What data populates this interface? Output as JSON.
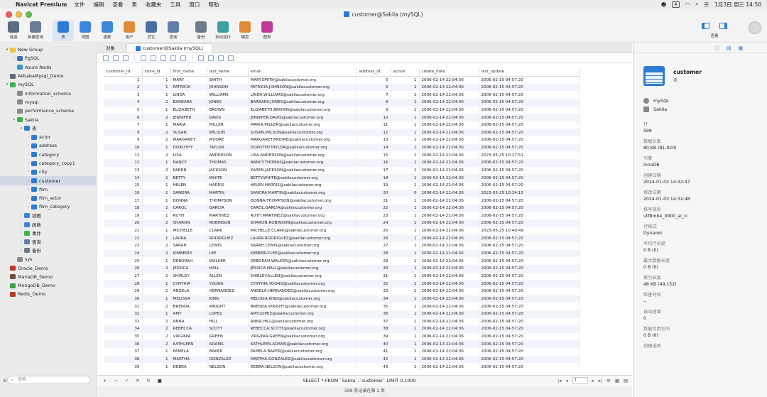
{
  "menubar": {
    "app": "Navicat Premium",
    "menus": [
      "文件",
      "编辑",
      "查看",
      "表",
      "收藏夹",
      "工具",
      "窗口",
      "帮助"
    ],
    "ime": "A",
    "datetime": "1月3日 周三 14:50"
  },
  "window": {
    "title": "customer@Sakila (mySQL)"
  },
  "toolbar": {
    "tools": [
      {
        "label": "连接",
        "icon": "connect-icon",
        "color": "#5a6b82"
      },
      {
        "label": "新建查询",
        "icon": "new-query-icon",
        "color": "#6b7c93"
      },
      {
        "label": "表",
        "icon": "table-icon",
        "color": "#2e7bd6",
        "active": true
      },
      {
        "label": "视图",
        "icon": "view-icon",
        "color": "#3b86d8"
      },
      {
        "label": "函数",
        "icon": "function-icon",
        "color": "#3b86d8"
      },
      {
        "label": "用户",
        "icon": "user-icon",
        "color": "#e08a3c"
      },
      {
        "label": "其它",
        "icon": "tools-icon",
        "color": "#4a6fa5"
      },
      {
        "label": "查询",
        "icon": "query-icon",
        "color": "#5f7fa8"
      },
      {
        "label": "备份",
        "icon": "backup-icon",
        "color": "#6c7a8a"
      },
      {
        "label": "自动运行",
        "icon": "robot-icon",
        "color": "#3aa0a0"
      },
      {
        "label": "模型",
        "icon": "model-icon",
        "color": "#e08a3c"
      },
      {
        "label": "图表",
        "icon": "chart-icon",
        "color": "#c0399a"
      }
    ],
    "view_label": "查看"
  },
  "sidebar": {
    "search_placeholder": "搜索",
    "nodes": [
      {
        "label": "New Group",
        "level": 0,
        "arrow": "▾",
        "color": "#f0c040"
      },
      {
        "label": "PgSQL",
        "level": 1,
        "arrow": "›",
        "color": "#3b6fb6"
      },
      {
        "label": "Azure Redis",
        "level": 1,
        "arrow": "",
        "color": "#2f9bd6"
      },
      {
        "label": "AlibabaMysql_Demo",
        "level": 0,
        "arrow": "",
        "color": "#5b6b7b"
      },
      {
        "label": "mySQL",
        "level": 0,
        "arrow": "▾",
        "color": "#3bb34a"
      },
      {
        "label": "information_schema",
        "level": 1,
        "arrow": "",
        "color": "#8a8a8a"
      },
      {
        "label": "mysql",
        "level": 1,
        "arrow": "",
        "color": "#8a8a8a"
      },
      {
        "label": "performance_schema",
        "level": 1,
        "arrow": "",
        "color": "#8a8a8a"
      },
      {
        "label": "Sakila",
        "level": 1,
        "arrow": "▾",
        "color": "#3bb34a"
      },
      {
        "label": "表",
        "level": 2,
        "arrow": "▾",
        "color": "#2e7bd6"
      },
      {
        "label": "actor",
        "level": 3,
        "arrow": "›",
        "color": "#2e7bd6"
      },
      {
        "label": "address",
        "level": 3,
        "arrow": "›",
        "color": "#2e7bd6"
      },
      {
        "label": "category",
        "level": 3,
        "arrow": "›",
        "color": "#2e7bd6"
      },
      {
        "label": "category_copy1",
        "level": 3,
        "arrow": "›",
        "color": "#2e7bd6"
      },
      {
        "label": "city",
        "level": 3,
        "arrow": "›",
        "color": "#2e7bd6"
      },
      {
        "label": "customer",
        "level": 3,
        "arrow": "›",
        "color": "#2e7bd6",
        "selected": true
      },
      {
        "label": "film",
        "level": 3,
        "arrow": "›",
        "color": "#2e7bd6"
      },
      {
        "label": "film_actor",
        "level": 3,
        "arrow": "›",
        "color": "#2e7bd6"
      },
      {
        "label": "film_category",
        "level": 3,
        "arrow": "›",
        "color": "#2e7bd6"
      },
      {
        "label": "视图",
        "level": 2,
        "arrow": "›",
        "color": "#3b86d8"
      },
      {
        "label": "函数",
        "level": 2,
        "arrow": "›",
        "color": "#3b86d8"
      },
      {
        "label": "事件",
        "level": 2,
        "arrow": "›",
        "color": "#3bb34a"
      },
      {
        "label": "查询",
        "level": 2,
        "arrow": "›",
        "color": "#5f7fa8"
      },
      {
        "label": "备份",
        "level": 2,
        "arrow": "›",
        "color": "#6c7a8a"
      },
      {
        "label": "sys",
        "level": 1,
        "arrow": "",
        "color": "#8a8a8a"
      },
      {
        "label": "Oracle_Demo",
        "level": 0,
        "arrow": "",
        "color": "#c0392b"
      },
      {
        "label": "MariaDB_Demo",
        "level": 0,
        "arrow": "",
        "color": "#6b4f3b"
      },
      {
        "label": "MongoDB_Demo",
        "level": 0,
        "arrow": "",
        "color": "#3aa04a"
      },
      {
        "label": "Redis_Demo",
        "level": 0,
        "arrow": "",
        "color": "#c0392b"
      }
    ]
  },
  "tabs": [
    {
      "label": "对象",
      "active": false
    },
    {
      "label": "customer@Sakila (mySQL)",
      "active": true
    }
  ],
  "grid": {
    "columns": [
      "customer_id",
      "store_id",
      "first_name",
      "last_name",
      "email",
      "address_id",
      "active",
      "create_date",
      "last_update"
    ],
    "rows": [
      [
        "1",
        "1",
        "MARY",
        "SMITH",
        "MARY.SMITH@sakilacustomer.org",
        "5",
        "1",
        "2006-02-14 22:04:36",
        "2006-02-15 04:57:20"
      ],
      [
        "2",
        "1",
        "PATRICIA",
        "JOHNSON",
        "PATRICIA.JOHNSON@sakilacustomer.org",
        "6",
        "1",
        "2006-02-14 22:04:36",
        "2006-02-15 04:57:20"
      ],
      [
        "3",
        "1",
        "LINDA",
        "WILLIAMS",
        "LINDA.WILLIAMS@sakilacustomer.org",
        "7",
        "1",
        "2006-02-14 22:04:36",
        "2006-02-15 04:57:20"
      ],
      [
        "4",
        "2",
        "BARBARA",
        "JONES",
        "BARBARA.JONES@sakilacustomer.org",
        "8",
        "1",
        "2006-02-14 22:04:36",
        "2006-02-15 04:57:20"
      ],
      [
        "5",
        "1",
        "ELIZABETH",
        "BROWN",
        "ELIZABETH.BROWN@sakilacustomer.org",
        "9",
        "1",
        "2006-02-14 22:04:36",
        "2006-02-15 04:57:20"
      ],
      [
        "6",
        "2",
        "JENNIFER",
        "DAVIS",
        "JENNIFER.DAVIS@sakilacustomer.org",
        "10",
        "1",
        "2006-02-14 22:04:36",
        "2006-02-15 04:57:20"
      ],
      [
        "7",
        "1",
        "MARIA",
        "MILLER",
        "MARIA.MILLER@sakilacustomer.org",
        "11",
        "1",
        "2006-02-14 22:04:36",
        "2006-02-15 04:57:20"
      ],
      [
        "8",
        "2",
        "SUSAN",
        "WILSON",
        "SUSAN.WILSON@sakilacustomer.org",
        "12",
        "1",
        "2006-02-14 22:04:36",
        "2006-02-15 04:57:20"
      ],
      [
        "9",
        "2",
        "MARGARET",
        "MOORE",
        "MARGARET.MOORE@sakilacustomer.org",
        "13",
        "1",
        "2006-02-14 22:04:36",
        "2006-02-15 04:57:20"
      ],
      [
        "10",
        "1",
        "DOROTHY",
        "TAYLOR",
        "DOROTHY.TAYLOR@sakilacustomer.org",
        "14",
        "1",
        "2006-02-14 22:04:36",
        "2006-02-15 04:57:20"
      ],
      [
        "11",
        "2",
        "LISA",
        "ANDERSON",
        "LISA.ANDERSON@sakilacustomer.org",
        "15",
        "1",
        "2006-02-14 22:04:36",
        "2023-05-25 10:27:51"
      ],
      [
        "12",
        "1",
        "NANCY",
        "THOMAS",
        "NANCY.THOMAS@sakilacustomer.org",
        "16",
        "1",
        "2006-02-14 22:04:36",
        "2006-02-15 04:57:20"
      ],
      [
        "13",
        "2",
        "KAREN",
        "JACKSON",
        "KAREN.JACKSON@sakilacustomer.org",
        "17",
        "1",
        "2006-02-14 22:04:36",
        "2006-02-15 04:57:20"
      ],
      [
        "14",
        "2",
        "BETTY",
        "WHITE",
        "BETTY.WHITE@sakilacustomer.org",
        "18",
        "1",
        "2006-02-14 22:04:36",
        "2006-02-15 04:57:20"
      ],
      [
        "15",
        "1",
        "HELEN",
        "HARRIS",
        "HELEN.HARRIS@sakilacustomer.org",
        "19",
        "1",
        "2006-02-14 22:04:36",
        "2006-02-15 04:57:20"
      ],
      [
        "16",
        "2",
        "SANDRA",
        "MARTIN",
        "SANDRA.MARTIN@sakilacustomer.org",
        "20",
        "0",
        "2006-02-14 22:04:36",
        "2023-05-25 10:34:15"
      ],
      [
        "17",
        "1",
        "DONNA",
        "THOMPSON",
        "DONNA.THOMPSON@sakilacustomer.org",
        "21",
        "1",
        "2006-02-14 22:04:36",
        "2006-02-15 04:57:20"
      ],
      [
        "18",
        "2",
        "CAROL",
        "GARCIA",
        "CAROL.GARCIA@sakilacustomer.org",
        "22",
        "1",
        "2006-02-14 22:04:36",
        "2006-02-15 04:57:20"
      ],
      [
        "19",
        "1",
        "RUTH",
        "MARTINEZ",
        "RUTH.MARTINEZ@sakilacustomer.org",
        "23",
        "1",
        "2006-02-14 22:04:36",
        "2006-02-15 04:57:20"
      ],
      [
        "20",
        "2",
        "SHARON",
        "ROBINSON",
        "SHARON.ROBINSON@sakilacustomer.org",
        "24",
        "1",
        "2006-02-14 22:04:36",
        "2006-02-15 04:57:20"
      ],
      [
        "21",
        "1",
        "MICHELLE",
        "CLARK",
        "MICHELLE.CLARK@sakilacustomer.org",
        "25",
        "1",
        "2006-02-14 22:04:36",
        "2023-05-25 10:40:49"
      ],
      [
        "22",
        "1",
        "LAURA",
        "RODRIGUEZ",
        "LAURA.RODRIGUEZ@sakilacustomer.org",
        "26",
        "1",
        "2006-02-14 22:04:36",
        "2006-02-15 04:57:20"
      ],
      [
        "23",
        "2",
        "SARAH",
        "LEWIS",
        "SARAH.LEWIS@sakilacustomer.org",
        "27",
        "1",
        "2006-02-14 22:04:36",
        "2006-02-15 04:57:20"
      ],
      [
        "24",
        "2",
        "KIMBERLY",
        "LEE",
        "KIMBERLY.LEE@sakilacustomer.org",
        "28",
        "1",
        "2006-02-14 22:04:36",
        "2006-02-15 04:57:20"
      ],
      [
        "25",
        "1",
        "DEBORAH",
        "WALKER",
        "DEBORAH.WALKER@sakilacustomer.org",
        "29",
        "1",
        "2006-02-14 22:04:36",
        "2006-02-15 04:57:20"
      ],
      [
        "26",
        "2",
        "JESSICA",
        "HALL",
        "JESSICA.HALL@sakilacustomer.org",
        "30",
        "1",
        "2006-02-14 22:04:36",
        "2006-02-15 04:57:20"
      ],
      [
        "27",
        "2",
        "SHIRLEY",
        "ALLEN",
        "SHIRLEY.ALLEN@sakilacustomer.org",
        "31",
        "1",
        "2006-02-14 22:04:36",
        "2006-02-15 04:57:20"
      ],
      [
        "28",
        "1",
        "CYNTHIA",
        "YOUNG",
        "CYNTHIA.YOUNG@sakilacustomer.org",
        "32",
        "1",
        "2006-02-14 22:04:36",
        "2006-02-15 04:57:20"
      ],
      [
        "29",
        "2",
        "ANGELA",
        "HERNANDEZ",
        "ANGELA.HERNANDEZ@sakilacustomer.org",
        "33",
        "1",
        "2006-02-14 22:04:36",
        "2006-02-15 04:57:20"
      ],
      [
        "30",
        "1",
        "MELISSA",
        "KING",
        "MELISSA.KING@sakilacustomer.org",
        "34",
        "1",
        "2006-02-14 22:04:36",
        "2006-02-15 04:57:20"
      ],
      [
        "31",
        "2",
        "BRENDA",
        "WRIGHT",
        "BRENDA.WRIGHT@sakilacustomer.org",
        "35",
        "1",
        "2006-02-14 22:04:36",
        "2006-02-15 04:57:20"
      ],
      [
        "32",
        "1",
        "AMY",
        "LOPEZ",
        "AMY.LOPEZ@sakilacustomer.org",
        "36",
        "1",
        "2006-02-14 22:04:36",
        "2006-02-15 04:57:20"
      ],
      [
        "33",
        "2",
        "ANNA",
        "HILL",
        "ANNA.HILL@sakilacustomer.org",
        "37",
        "1",
        "2006-02-14 22:04:36",
        "2006-02-15 04:57:20"
      ],
      [
        "34",
        "2",
        "REBECCA",
        "SCOTT",
        "REBECCA.SCOTT@sakilacustomer.org",
        "38",
        "1",
        "2006-02-14 22:04:36",
        "2006-02-15 04:57:20"
      ],
      [
        "35",
        "2",
        "VIRGINIA",
        "GREEN",
        "VIRGINIA.GREEN@sakilacustomer.org",
        "39",
        "1",
        "2006-02-14 22:04:36",
        "2006-02-15 04:57:20"
      ],
      [
        "36",
        "2",
        "KATHLEEN",
        "ADAMS",
        "KATHLEEN.ADAMS@sakilacustomer.org",
        "40",
        "1",
        "2006-02-14 22:04:36",
        "2006-02-15 04:57:20"
      ],
      [
        "37",
        "1",
        "PAMELA",
        "BAKER",
        "PAMELA.BAKER@sakilacustomer.org",
        "41",
        "1",
        "2006-02-14 22:04:36",
        "2006-02-15 04:57:20"
      ],
      [
        "38",
        "1",
        "MARTHA",
        "GONZALEZ",
        "MARTHA.GONZALEZ@sakilacustomer.org",
        "42",
        "1",
        "2006-02-14 22:04:36",
        "2006-02-15 04:57:20"
      ],
      [
        "39",
        "1",
        "DEBRA",
        "NELSON",
        "DEBRA.NELSON@sakilacustomer.org",
        "43",
        "1",
        "2006-02-14 22:04:36",
        "2006-02-15 04:57:20"
      ]
    ]
  },
  "statusbar": {
    "sql": "SELECT * FROM `Sakila`.`customer` LIMIT 0,1000",
    "page": "1",
    "record_info": "599 条记录在第 1 页"
  },
  "panel": {
    "object_name": "customer",
    "object_type": "表",
    "connection": "mySQL",
    "database": "Sakila",
    "props": [
      {
        "k": "行",
        "v": "599"
      },
      {
        "k": "数据长度",
        "v": "80 KB (81,920)"
      },
      {
        "k": "引擎",
        "v": "InnoDB"
      },
      {
        "k": "创建日期",
        "v": "2024-01-03 14:32:47"
      },
      {
        "k": "修改日期",
        "v": "2024-01-03 14:32:48"
      },
      {
        "k": "排序规则",
        "v": "utf8mb4_0900_ai_ci"
      },
      {
        "k": "行格式",
        "v": "Dynamic"
      },
      {
        "k": "平均行长度",
        "v": "0 B (0)"
      },
      {
        "k": "最大数据长度",
        "v": "0 B (0)"
      },
      {
        "k": "索引长度",
        "v": "48 KB (49,152)"
      },
      {
        "k": "检查时间",
        "v": "--"
      },
      {
        "k": "自动递增",
        "v": "0"
      },
      {
        "k": "数据可用空间",
        "v": "0 B (0)"
      },
      {
        "k": "创建选项",
        "v": ""
      }
    ]
  },
  "colors": {
    "accent": "#2e7bd6",
    "row_alt": "#f1f5fb",
    "sidebar_bg": "#ebebeb"
  }
}
